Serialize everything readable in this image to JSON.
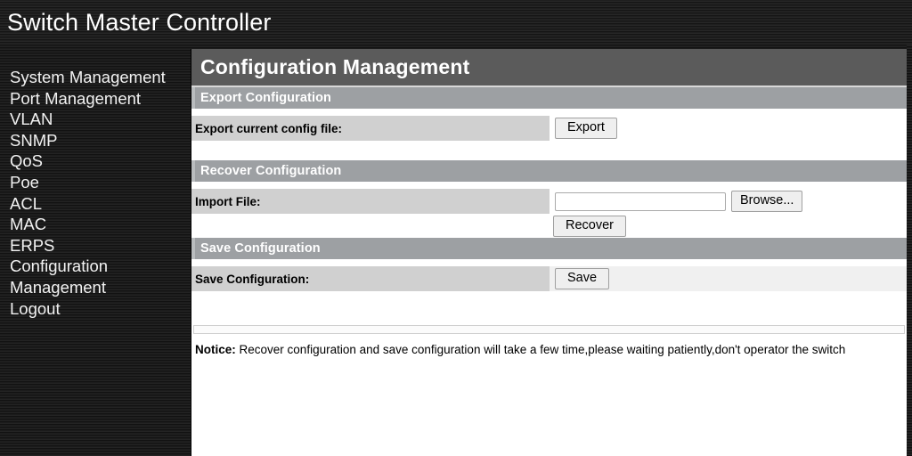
{
  "header": {
    "app_title": "Switch Master Controller"
  },
  "sidebar": {
    "items": [
      {
        "label": "System Management"
      },
      {
        "label": "Port Management"
      },
      {
        "label": "VLAN"
      },
      {
        "label": "SNMP"
      },
      {
        "label": "QoS"
      },
      {
        "label": "Poe"
      },
      {
        "label": "ACL"
      },
      {
        "label": "MAC"
      },
      {
        "label": "ERPS"
      },
      {
        "label": "Configuration Management"
      },
      {
        "label": "Logout"
      }
    ]
  },
  "main": {
    "page_title": "Configuration Management",
    "sections": {
      "export": {
        "title": "Export Configuration",
        "row_label": "Export current config file:",
        "button_label": "Export"
      },
      "recover": {
        "title": "Recover Configuration",
        "row_label": "Import File:",
        "file_value": "",
        "file_placeholder": "",
        "browse_label": "Browse...",
        "recover_label": "Recover"
      },
      "save": {
        "title": "Save Configuration",
        "row_label": "Save Configuration:",
        "button_label": "Save"
      }
    },
    "notice": {
      "label": "Notice:",
      "text": "Recover configuration and save configuration will take a few time,please waiting patiently,don't operator the switch"
    }
  },
  "colors": {
    "header_bg": "#1c1c1c",
    "title_bar": "#5b5b5b",
    "section_head": "#9da0a3",
    "label_cell": "#d0d0d0",
    "content_bg": "#ffffff"
  }
}
